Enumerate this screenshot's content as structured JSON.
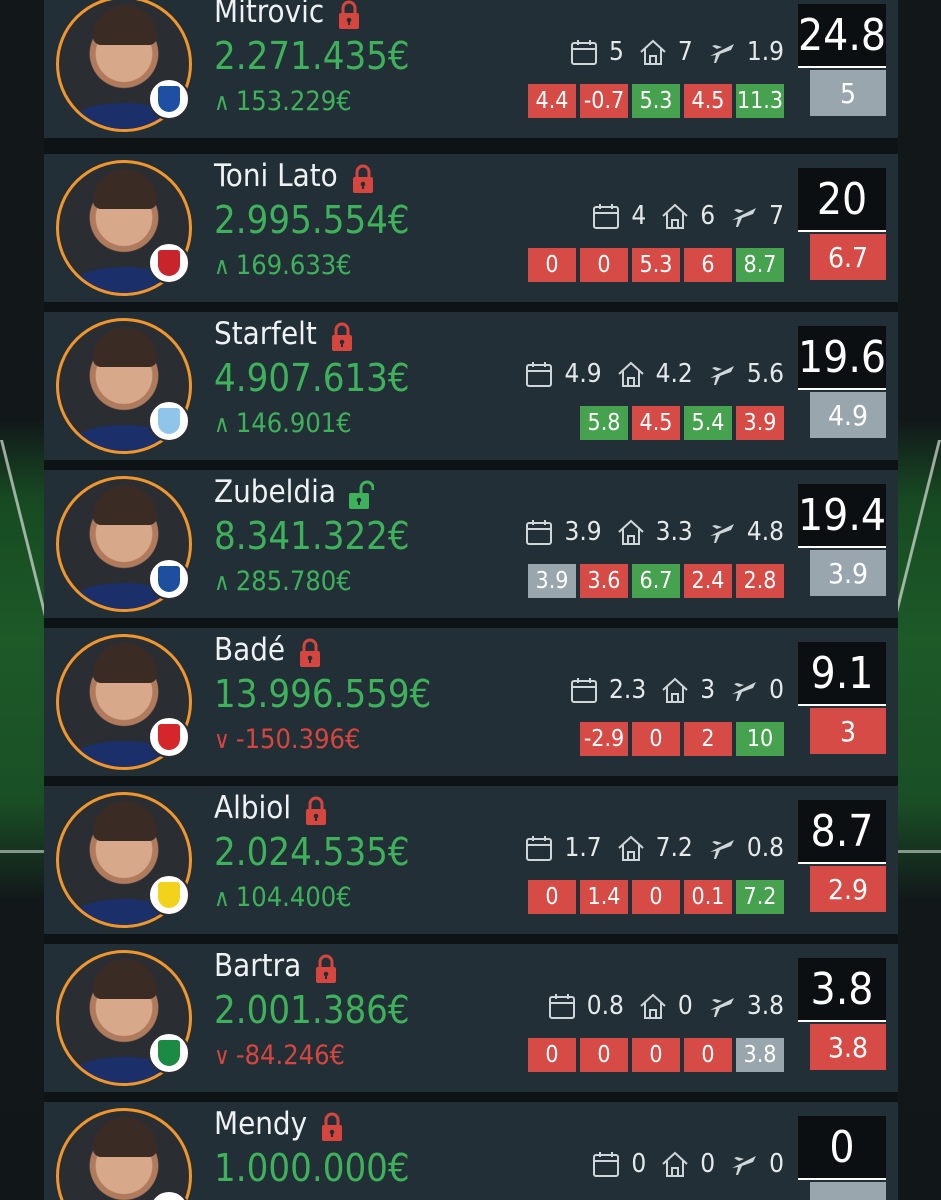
{
  "colors": {
    "green": "#47a24f",
    "red": "#d64b45",
    "grey": "#9aa6ad",
    "positive_text": "#3eb25a",
    "negative_text": "#d6463e",
    "avatar_ring": "#f0962d",
    "lock_locked": "#d6463e",
    "lock_unlocked": "#3eb25a",
    "card_bg": "#232f36"
  },
  "players": [
    {
      "name": "Mitrovic",
      "lock": "locked",
      "value": "2.271.435€",
      "trend": "up",
      "change": "153.229€",
      "stats": {
        "average": "5",
        "home": "7",
        "away": "1.9"
      },
      "recent": [
        {
          "v": "4.4",
          "c": "red"
        },
        {
          "v": "-0.7",
          "c": "red"
        },
        {
          "v": "5.3",
          "c": "green"
        },
        {
          "v": "4.5",
          "c": "red"
        },
        {
          "v": "11.3",
          "c": "green"
        }
      ],
      "points": "24.8",
      "last": "5",
      "last_color": "grey",
      "crest_color": "#1e4fa3"
    },
    {
      "name": "Toni Lato",
      "lock": "locked",
      "value": "2.995.554€",
      "trend": "up",
      "change": "169.633€",
      "stats": {
        "average": "4",
        "home": "6",
        "away": "7"
      },
      "recent": [
        {
          "v": "0",
          "c": "red"
        },
        {
          "v": "0",
          "c": "red"
        },
        {
          "v": "5.3",
          "c": "red"
        },
        {
          "v": "6",
          "c": "red"
        },
        {
          "v": "8.7",
          "c": "green"
        }
      ],
      "points": "20",
      "last": "6.7",
      "last_color": "red",
      "crest_color": "#c8242b"
    },
    {
      "name": "Starfelt",
      "lock": "locked",
      "value": "4.907.613€",
      "trend": "up",
      "change": "146.901€",
      "stats": {
        "average": "4.9",
        "home": "4.2",
        "away": "5.6"
      },
      "recent": [
        {
          "v": "5.8",
          "c": "green"
        },
        {
          "v": "4.5",
          "c": "red"
        },
        {
          "v": "5.4",
          "c": "green"
        },
        {
          "v": "3.9",
          "c": "red"
        }
      ],
      "points": "19.6",
      "last": "4.9",
      "last_color": "grey",
      "crest_color": "#8ec5e8"
    },
    {
      "name": "Zubeldia",
      "lock": "unlocked",
      "value": "8.341.322€",
      "trend": "up",
      "change": "285.780€",
      "stats": {
        "average": "3.9",
        "home": "3.3",
        "away": "4.8"
      },
      "recent": [
        {
          "v": "3.9",
          "c": "grey"
        },
        {
          "v": "3.6",
          "c": "red"
        },
        {
          "v": "6.7",
          "c": "green"
        },
        {
          "v": "2.4",
          "c": "red"
        },
        {
          "v": "2.8",
          "c": "red"
        }
      ],
      "points": "19.4",
      "last": "3.9",
      "last_color": "grey",
      "crest_color": "#1d4f9e"
    },
    {
      "name": "Badé",
      "lock": "locked",
      "value": "13.996.559€",
      "trend": "down",
      "change": "-150.396€",
      "stats": {
        "average": "2.3",
        "home": "3",
        "away": "0"
      },
      "recent": [
        {
          "v": "-2.9",
          "c": "red"
        },
        {
          "v": "0",
          "c": "red"
        },
        {
          "v": "2",
          "c": "red"
        },
        {
          "v": "10",
          "c": "green"
        }
      ],
      "points": "9.1",
      "last": "3",
      "last_color": "red",
      "crest_color": "#d4262b"
    },
    {
      "name": "Albiol",
      "lock": "locked",
      "value": "2.024.535€",
      "trend": "up",
      "change": "104.400€",
      "stats": {
        "average": "1.7",
        "home": "7.2",
        "away": "0.8"
      },
      "recent": [
        {
          "v": "0",
          "c": "red"
        },
        {
          "v": "1.4",
          "c": "red"
        },
        {
          "v": "0",
          "c": "red"
        },
        {
          "v": "0.1",
          "c": "red"
        },
        {
          "v": "7.2",
          "c": "green"
        }
      ],
      "points": "8.7",
      "last": "2.9",
      "last_color": "red",
      "crest_color": "#f3d21c"
    },
    {
      "name": "Bartra",
      "lock": "locked",
      "value": "2.001.386€",
      "trend": "down",
      "change": "-84.246€",
      "stats": {
        "average": "0.8",
        "home": "0",
        "away": "3.8"
      },
      "recent": [
        {
          "v": "0",
          "c": "red"
        },
        {
          "v": "0",
          "c": "red"
        },
        {
          "v": "0",
          "c": "red"
        },
        {
          "v": "0",
          "c": "red"
        },
        {
          "v": "3.8",
          "c": "grey"
        }
      ],
      "points": "3.8",
      "last": "3.8",
      "last_color": "red",
      "crest_color": "#1a8a45"
    },
    {
      "name": "Mendy",
      "lock": "locked",
      "value": "1.000.000€",
      "trend": "",
      "change": "",
      "stats": {
        "average": "0",
        "home": "0",
        "away": "0"
      },
      "recent": [],
      "points": "0",
      "last": "",
      "last_color": "grey",
      "crest_color": "#ffffff"
    }
  ],
  "icons": {
    "average": "calendar-icon",
    "home": "home-icon",
    "away": "plane-icon",
    "lock": "padlock-icon",
    "trend_up": "chevron-up-icon",
    "trend_down": "chevron-down-icon"
  }
}
